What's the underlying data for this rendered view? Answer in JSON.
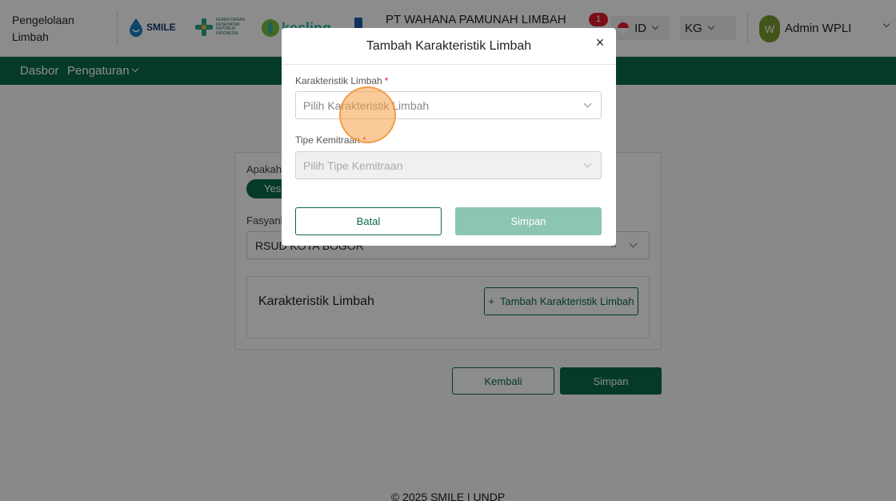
{
  "header": {
    "app_title": "Pengelolaan Limbah",
    "logos": {
      "smile": "SMILE",
      "kemkes": "KEMENTERIAN KESEHATAN REPUBLIK INDONESIA",
      "kesling": "kesling"
    },
    "company": "PT WAHANA PAMUNAH LIMBAH",
    "notification_count": "1",
    "language": "ID",
    "unit": "KG",
    "avatar_initial": "W",
    "user_name": "Admin WPLI"
  },
  "nav": {
    "dasbor": "Dasbor",
    "pengaturan": "Pengaturan"
  },
  "form": {
    "question_label": "Apakah",
    "toggle_yes": "Yes",
    "fasyankes_label": "Fasyank",
    "fasyankes_value": "RSUD KOTA BOGOR",
    "fasyankes_clear": "×",
    "karakteristik_title": "Karakteristik Limbah",
    "add_plus": "+",
    "add_button": "Tambah Karakteristik Limbah",
    "back_button": "Kembali",
    "save_button": "Simpan"
  },
  "modal": {
    "title": "Tambah Karakteristik Limbah",
    "close_symbol": "×",
    "required_mark": "*",
    "field1_label": "Karakteristik Limbah",
    "field1_placeholder": "Pilih Karakteristik Limbah",
    "field2_label": "Tipe Kemitraan",
    "field2_placeholder": "Pilih Tipe Kemitraan",
    "cancel_button": "Batal",
    "save_button": "Simpan"
  },
  "footer": {
    "text": "© 2025 SMILE | UNDP"
  },
  "colors": {
    "primary": "#0a6b48",
    "save_disabled": "#8cc6b0",
    "badge": "#e11d2a"
  }
}
